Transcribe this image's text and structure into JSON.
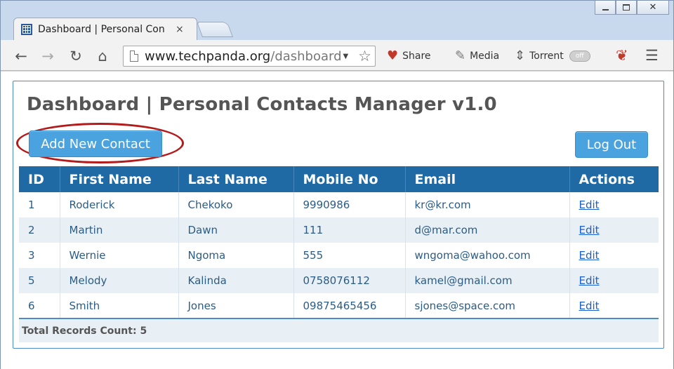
{
  "browser": {
    "tab_title": "Dashboard | Personal Con",
    "tab_close": "×",
    "url_host": "www.techpanda.org",
    "url_path": "/dashboard",
    "extensions": {
      "share_label": "Share",
      "media_label": "Media",
      "torrent_label": "Torrent",
      "torrent_toggle": "off"
    },
    "icons": [
      "back-arrow-icon",
      "forward-arrow-icon",
      "reload-icon",
      "home-icon",
      "page-icon",
      "star-icon",
      "heart-icon",
      "media-icon",
      "torrent-icon",
      "extension-icon",
      "menu-icon"
    ]
  },
  "page": {
    "title": "Dashboard | Personal Contacts Manager v1.0",
    "add_button": "Add New Contact",
    "logout_button": "Log Out"
  },
  "table": {
    "headers": [
      "ID",
      "First Name",
      "Last Name",
      "Mobile No",
      "Email",
      "Actions"
    ],
    "rows": [
      [
        "1",
        "Roderick",
        "Chekoko",
        "9990986",
        "kr@kr.com",
        "Edit"
      ],
      [
        "2",
        "Martin",
        "Dawn",
        "111",
        "d@mar.com",
        "Edit"
      ],
      [
        "3",
        "Wernie",
        "Ngoma",
        "555",
        "wngoma@wahoo.com",
        "Edit"
      ],
      [
        "5",
        "Melody",
        "Kalinda",
        "0758076112",
        "kamel@gmail.com",
        "Edit"
      ],
      [
        "6",
        "Smith",
        "Jones",
        "09875465456",
        "sjones@space.com",
        "Edit"
      ]
    ],
    "footer": "Total Records Count: 5"
  },
  "colors": {
    "header_bg": "#1f6aa5",
    "button_bg": "#4aa3df",
    "highlight": "#b31b1b",
    "alt_row": "#e9f0f5"
  }
}
